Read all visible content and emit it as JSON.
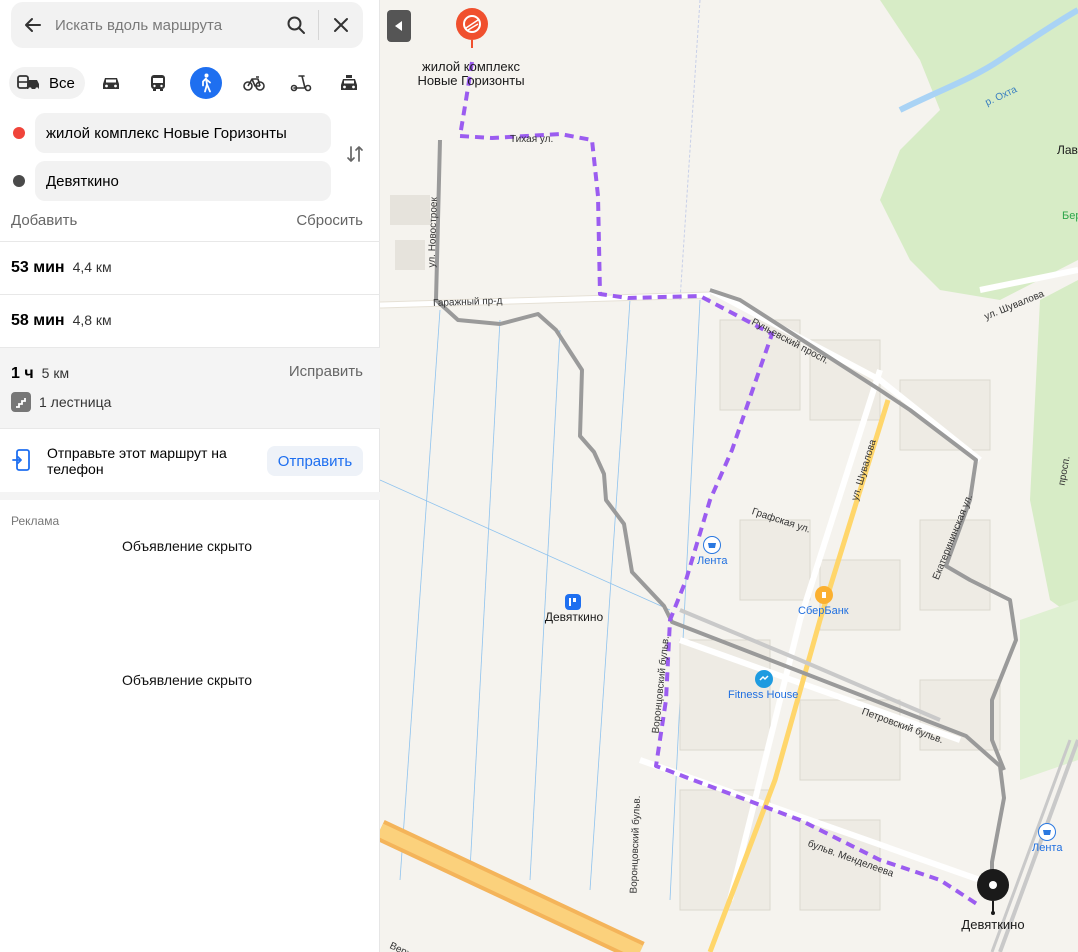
{
  "search": {
    "placeholder": "Искать вдоль маршрута"
  },
  "modes": {
    "all_label": "Все"
  },
  "points": {
    "from": "жилой комплекс Новые Горизонты",
    "to": "Девяткино"
  },
  "actions": {
    "add": "Добавить",
    "reset": "Сбросить"
  },
  "routes": [
    {
      "time": "53 мин",
      "distance": "4,4 км"
    },
    {
      "time": "58 мин",
      "distance": "4,8 км"
    },
    {
      "time": "1 ч",
      "distance": "5 км",
      "fix": "Исправить",
      "stairs": "1 лестница"
    }
  ],
  "send": {
    "text": "Отправьте этот маршрут на телефон",
    "button": "Отправить"
  },
  "ads": {
    "label": "Реклама",
    "hidden_1": "Объявление скрыто",
    "hidden_2": "Объявление скрыто"
  },
  "map": {
    "start_label": "жилой комплекс Новые Горизонты",
    "end_label": "Девяткино",
    "station_label": "Девяткино",
    "district_label": "Лав",
    "bank_label_right": "Бер",
    "river_label": "р. Охта",
    "poi": {
      "lenta_1": "Лента",
      "sberbank": "СберБанк",
      "fitness": "Fitness House",
      "lenta_2": "Лента"
    },
    "streets": {
      "tikhaya": "Тихая ул.",
      "novostroek": "ул. Новостроек",
      "garazhny": "Гаражный пр-д",
      "ruchyevsky": "Ручьевский просп.",
      "shuvalova_1": "ул. Шувалова",
      "shuvalova_2": "ул. Шувалова",
      "grafskaya": "Графская ул.",
      "ekaterininskaya": "Екатерининская ул.",
      "prosp": "просп.",
      "vorontsovsky_1": "Воронцовский бульв.",
      "vorontsovsky_2": "Воронцовский бульв.",
      "petrovsky": "Петровский бульв.",
      "mendeleeva": "бульв. Менделеева",
      "verkh": "Верх"
    },
    "colors": {
      "route": "#9b5cf0",
      "alt": "#9a9a9a",
      "start_pin": "#f0502e"
    }
  }
}
